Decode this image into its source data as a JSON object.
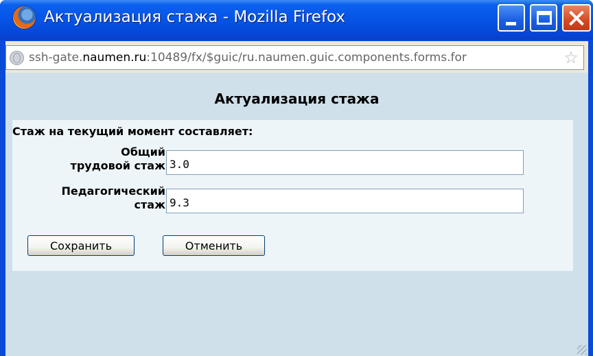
{
  "window": {
    "title": "Актуализация стажа - Mozilla Firefox"
  },
  "address_bar": {
    "url_prefix": "ssh-gate.",
    "url_host": "naumen.ru",
    "url_rest": ":10489/fx/$guic/ru.naumen.guic.components.forms.for"
  },
  "form": {
    "title": "Актуализация стажа",
    "heading": "Стаж на текущий момент составляет:",
    "fields": [
      {
        "label": "Общий\nтрудовой стаж",
        "value": "3.0"
      },
      {
        "label": "Педагогический\nстаж",
        "value": "9.3"
      }
    ],
    "save_label": "Сохранить",
    "cancel_label": "Отменить"
  },
  "icons": {
    "app": "firefox-icon",
    "address": "globe-icon",
    "bookmark": "star-icon"
  },
  "colors": {
    "titlebar": "#0554e6",
    "content_bg": "#cfe0ea",
    "panel_bg": "#eef5f8",
    "close_button": "#d44a25"
  }
}
